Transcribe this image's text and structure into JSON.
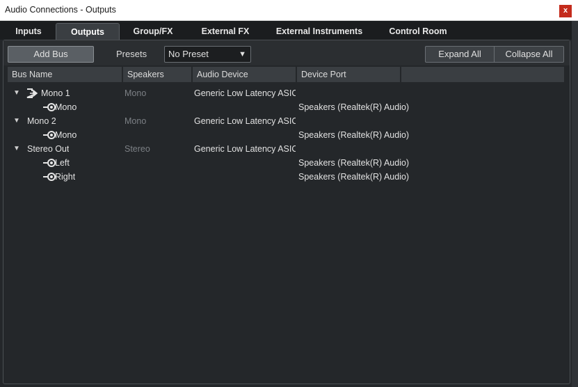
{
  "window": {
    "title": "Audio Connections - Outputs",
    "close_label": "x"
  },
  "tabs": [
    {
      "label": "Inputs"
    },
    {
      "label": "Outputs"
    },
    {
      "label": "Group/FX"
    },
    {
      "label": "External FX"
    },
    {
      "label": "External Instruments"
    },
    {
      "label": "Control Room"
    }
  ],
  "active_tab": "Outputs",
  "toolbar": {
    "add_bus_label": "Add Bus",
    "presets_label": "Presets",
    "preset_value": "No Preset",
    "expand_all_label": "Expand All",
    "collapse_all_label": "Collapse All"
  },
  "columns": [
    "Bus Name",
    "Speakers",
    "Audio Device",
    "Device Port",
    ""
  ],
  "rows": [
    {
      "name": "Mono 1",
      "speakers": "Mono",
      "device": "Generic Low Latency ASIO D",
      "port": ""
    },
    {
      "name": "Mono",
      "speakers": "",
      "device": "",
      "port": "Speakers (Realtek(R) Audio)"
    },
    {
      "name": "Mono 2",
      "speakers": "Mono",
      "device": "Generic Low Latency ASIO D",
      "port": ""
    },
    {
      "name": "Mono",
      "speakers": "",
      "device": "",
      "port": "Speakers (Realtek(R) Audio)"
    },
    {
      "name": "Stereo Out",
      "speakers": "Stereo",
      "device": "Generic Low Latency ASIO D",
      "port": ""
    },
    {
      "name": "Left",
      "speakers": "",
      "device": "",
      "port": "Speakers (Realtek(R) Audio)"
    },
    {
      "name": "Right",
      "speakers": "",
      "device": "",
      "port": "Speakers (Realtek(R) Audio)"
    }
  ],
  "colors": {
    "accent_close": "#c42b1c",
    "panel_bg": "#24272a",
    "header_bg": "#3a3e42"
  },
  "icons": {
    "expand": "triangle-down-icon",
    "main_output": "output-arrow-icon",
    "channel": "channel-target-icon"
  }
}
